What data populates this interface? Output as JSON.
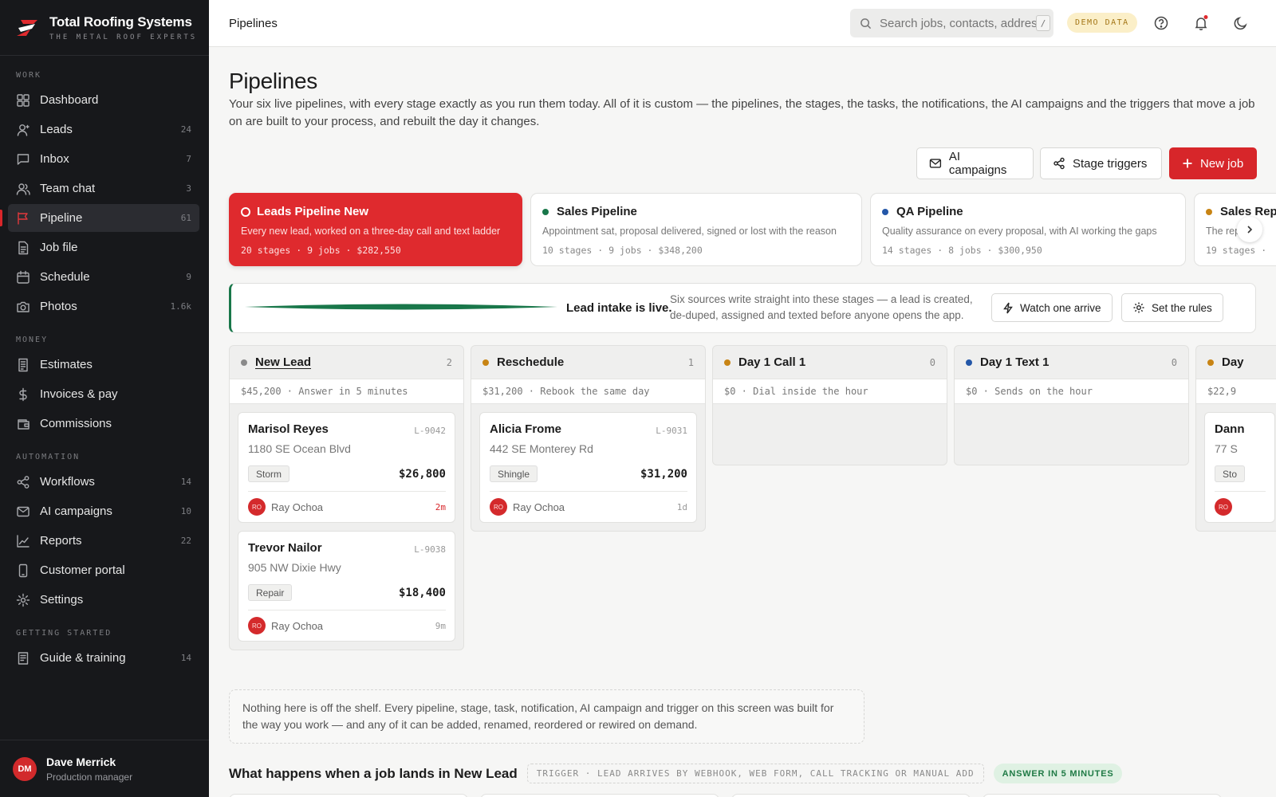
{
  "brand": {
    "name": "Total Roofing Systems",
    "tagline": "THE METAL ROOF EXPERTS"
  },
  "sidebar": {
    "sections": [
      {
        "label": "WORK",
        "items": [
          {
            "label": "Dashboard",
            "count": "",
            "icon": "dashboard-icon"
          },
          {
            "label": "Leads",
            "count": "24",
            "icon": "user-icon"
          },
          {
            "label": "Inbox",
            "count": "7",
            "icon": "chat-bubble-icon"
          },
          {
            "label": "Team chat",
            "count": "3",
            "icon": "team-icon"
          },
          {
            "label": "Pipeline",
            "count": "61",
            "icon": "pipeline-icon",
            "active": true
          },
          {
            "label": "Job file",
            "count": "",
            "icon": "document-icon"
          },
          {
            "label": "Schedule",
            "count": "9",
            "icon": "calendar-icon"
          },
          {
            "label": "Photos",
            "count": "1.6k",
            "icon": "camera-icon"
          }
        ]
      },
      {
        "label": "MONEY",
        "items": [
          {
            "label": "Estimates",
            "count": "",
            "icon": "receipt-icon"
          },
          {
            "label": "Invoices & pay",
            "count": "",
            "icon": "dollar-icon"
          },
          {
            "label": "Commissions",
            "count": "",
            "icon": "wallet-icon"
          }
        ]
      },
      {
        "label": "AUTOMATION",
        "items": [
          {
            "label": "Workflows",
            "count": "14",
            "icon": "share-icon"
          },
          {
            "label": "AI campaigns",
            "count": "10",
            "icon": "mail-icon"
          },
          {
            "label": "Reports",
            "count": "22",
            "icon": "chart-icon"
          },
          {
            "label": "Customer portal",
            "count": "",
            "icon": "phone-icon"
          },
          {
            "label": "Settings",
            "count": "",
            "icon": "gear-icon"
          }
        ]
      },
      {
        "label": "GETTING STARTED",
        "items": [
          {
            "label": "Guide & training",
            "count": "14",
            "icon": "book-icon"
          }
        ]
      }
    ],
    "user": {
      "initials": "DM",
      "name": "Dave Merrick",
      "role": "Production manager"
    }
  },
  "topbar": {
    "breadcrumb": "Pipelines",
    "search_placeholder": "Search jobs, contacts, addresses",
    "search_kbd": "/",
    "demo_badge": "DEMO DATA"
  },
  "page": {
    "title": "Pipelines",
    "intro": "Your six live pipelines, with every stage exactly as you run them today. All of it is custom — the pipelines, the stages, the tasks, the notifications, the AI campaigns and the triggers that move a job on are built to your process, and rebuilt the day it changes.",
    "buttons": {
      "ai_campaigns": "AI campaigns",
      "stage_triggers": "Stage triggers",
      "new_job": "New job"
    }
  },
  "pipelines": [
    {
      "name": "Leads Pipeline New",
      "desc": "Every new lead, worked on a three-day call and text ladder",
      "meta": "20 stages · 9 jobs · $282,550",
      "selected": true,
      "dot": "#ffffff"
    },
    {
      "name": "Sales Pipeline",
      "desc": "Appointment sat, proposal delivered, signed or lost with the reason",
      "meta": "10 stages · 9 jobs · $348,200",
      "dot": "#19774a"
    },
    {
      "name": "QA Pipeline",
      "desc": "Quality assurance on every proposal, with AI working the gaps",
      "meta": "14 stages · 8 jobs · $300,950",
      "dot": "#2457a8"
    },
    {
      "name": "Sales Rep",
      "desc": "The rep",
      "meta": "19 stages ·",
      "dot": "#c88414"
    }
  ],
  "intake": {
    "live": "Lead intake is live.",
    "text": "Six sources write straight into these stages — a lead is created, de-duped, assigned and texted before anyone opens the app.",
    "watch": "Watch one arrive",
    "rules": "Set the rules"
  },
  "stages": [
    {
      "name": "New Lead",
      "count": "2",
      "dot": "#8a8a8a",
      "sub": "$45,200 · Answer in 5 minutes",
      "jobs": [
        {
          "name": "Marisol Reyes",
          "id": "L-9042",
          "address": "1180 SE Ocean Blvd",
          "tag": "Storm",
          "amount": "$26,800",
          "owner": "Ray Ochoa",
          "owner_initials": "RO",
          "age": "2m",
          "age_red": true
        },
        {
          "name": "Trevor Nailor",
          "id": "L-9038",
          "address": "905 NW Dixie Hwy",
          "tag": "Repair",
          "amount": "$18,400",
          "owner": "Ray Ochoa",
          "owner_initials": "RO",
          "age": "9m",
          "age_red": false
        }
      ]
    },
    {
      "name": "Reschedule",
      "count": "1",
      "dot": "#c88414",
      "sub": "$31,200 · Rebook the same day",
      "jobs": [
        {
          "name": "Alicia Frome",
          "id": "L-9031",
          "address": "442 SE Monterey Rd",
          "tag": "Shingle",
          "amount": "$31,200",
          "owner": "Ray Ochoa",
          "owner_initials": "RO",
          "age": "1d",
          "age_red": false
        }
      ]
    },
    {
      "name": "Day 1 Call 1",
      "count": "0",
      "dot": "#c88414",
      "sub": "$0 · Dial inside the hour",
      "jobs": []
    },
    {
      "name": "Day 1 Text 1",
      "count": "0",
      "dot": "#2457a8",
      "sub": "$0 · Sends on the hour",
      "jobs": []
    },
    {
      "name": "Day",
      "count": "",
      "dot": "#c88414",
      "sub": "$22,9",
      "jobs": [
        {
          "name": "Dann",
          "id": "",
          "address": "77 S",
          "tag": "Sto",
          "amount": "",
          "owner": "",
          "owner_initials": "RO",
          "age": "",
          "age_red": false
        }
      ]
    }
  ],
  "note": "Nothing here is off the shelf. Every pipeline, stage, task, notification, AI campaign and trigger on this screen was built for the way you work — and any of it can be added, renamed, reordered or rewired on demand.",
  "footer": {
    "title": "What happens when a job lands in New Lead",
    "trigger": "TRIGGER · LEAD ARRIVES BY WEBHOOK, WEB FORM, CALL TRACKING OR MANUAL ADD",
    "answer": "ANSWER IN 5 MINUTES"
  },
  "colors": {
    "accent": "#d7262a",
    "sidebar_bg": "#17181b",
    "live_green": "#19774a"
  }
}
